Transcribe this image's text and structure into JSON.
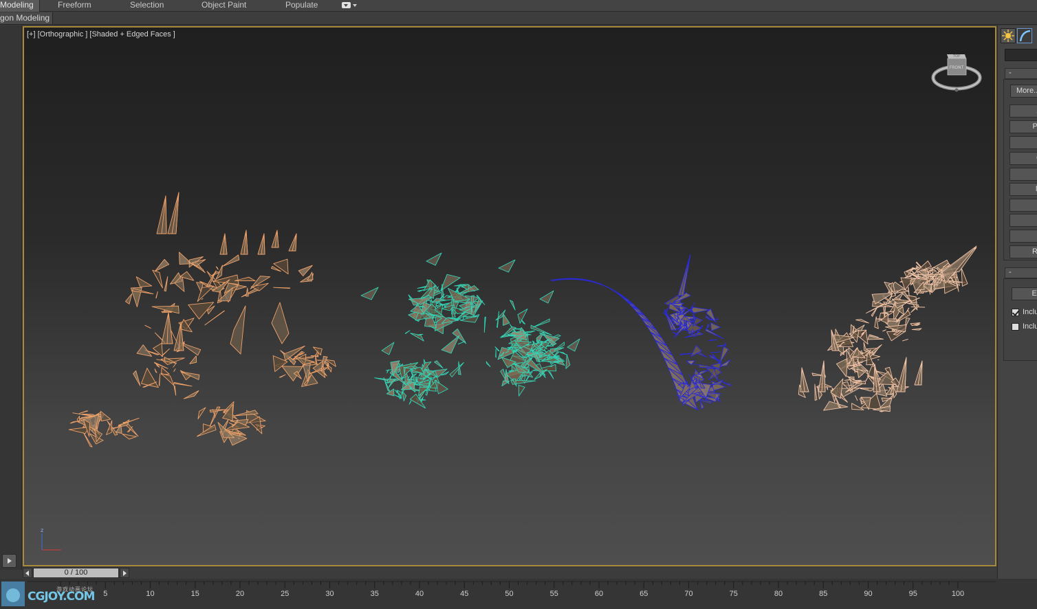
{
  "ribbon": {
    "tabs": [
      {
        "label": "Modeling",
        "active": true
      },
      {
        "label": "Freeform",
        "active": false
      },
      {
        "label": "Selection",
        "active": false
      },
      {
        "label": "Object Paint",
        "active": false
      },
      {
        "label": "Populate",
        "active": false
      }
    ],
    "dropdown_icon": "ribbon-options-icon"
  },
  "subribbon": {
    "panel_label": "gon Modeling"
  },
  "viewport": {
    "label": "[+] [Orthographic ] [Shaded + Edged Faces ]",
    "border_color": "#a88a3a",
    "viewcube": {
      "top_face": "TOP",
      "front_face": "FRONT"
    },
    "axis": {
      "z": "z"
    },
    "objects": [
      {
        "name": "skeleton-dragon",
        "wire_color": "#f0a26a"
      },
      {
        "name": "bone-pile",
        "wire_color": "#2fd6b8"
      },
      {
        "name": "curved-spike",
        "wire_color": "#2a2ad8"
      },
      {
        "name": "spine-nest",
        "wire_color": "#f3c5a8"
      }
    ]
  },
  "command_panel": {
    "tabs": [
      {
        "icon": "create-icon"
      },
      {
        "icon": "modify-icon"
      }
    ],
    "rollout1_label": "-",
    "more_button": "More...",
    "buttons": [
      "A",
      "Pe",
      "",
      "C",
      "",
      "M",
      "",
      "",
      "F",
      "Re"
    ],
    "rollout2_label": "-",
    "edit_button": "Ed",
    "checkboxes": [
      {
        "label": "Inclu",
        "checked": true
      },
      {
        "label": "Inclu",
        "checked": false
      }
    ]
  },
  "time_slider": {
    "value": "0 / 100"
  },
  "track_bar": {
    "ticks": [
      "5",
      "10",
      "15",
      "20",
      "25",
      "30",
      "35",
      "40",
      "45",
      "50",
      "55",
      "60",
      "65",
      "70",
      "75",
      "80",
      "85",
      "90",
      "95",
      "100"
    ]
  },
  "watermark": {
    "text": "CGJOY.COM",
    "subtitle": "游戏动画论坛"
  }
}
